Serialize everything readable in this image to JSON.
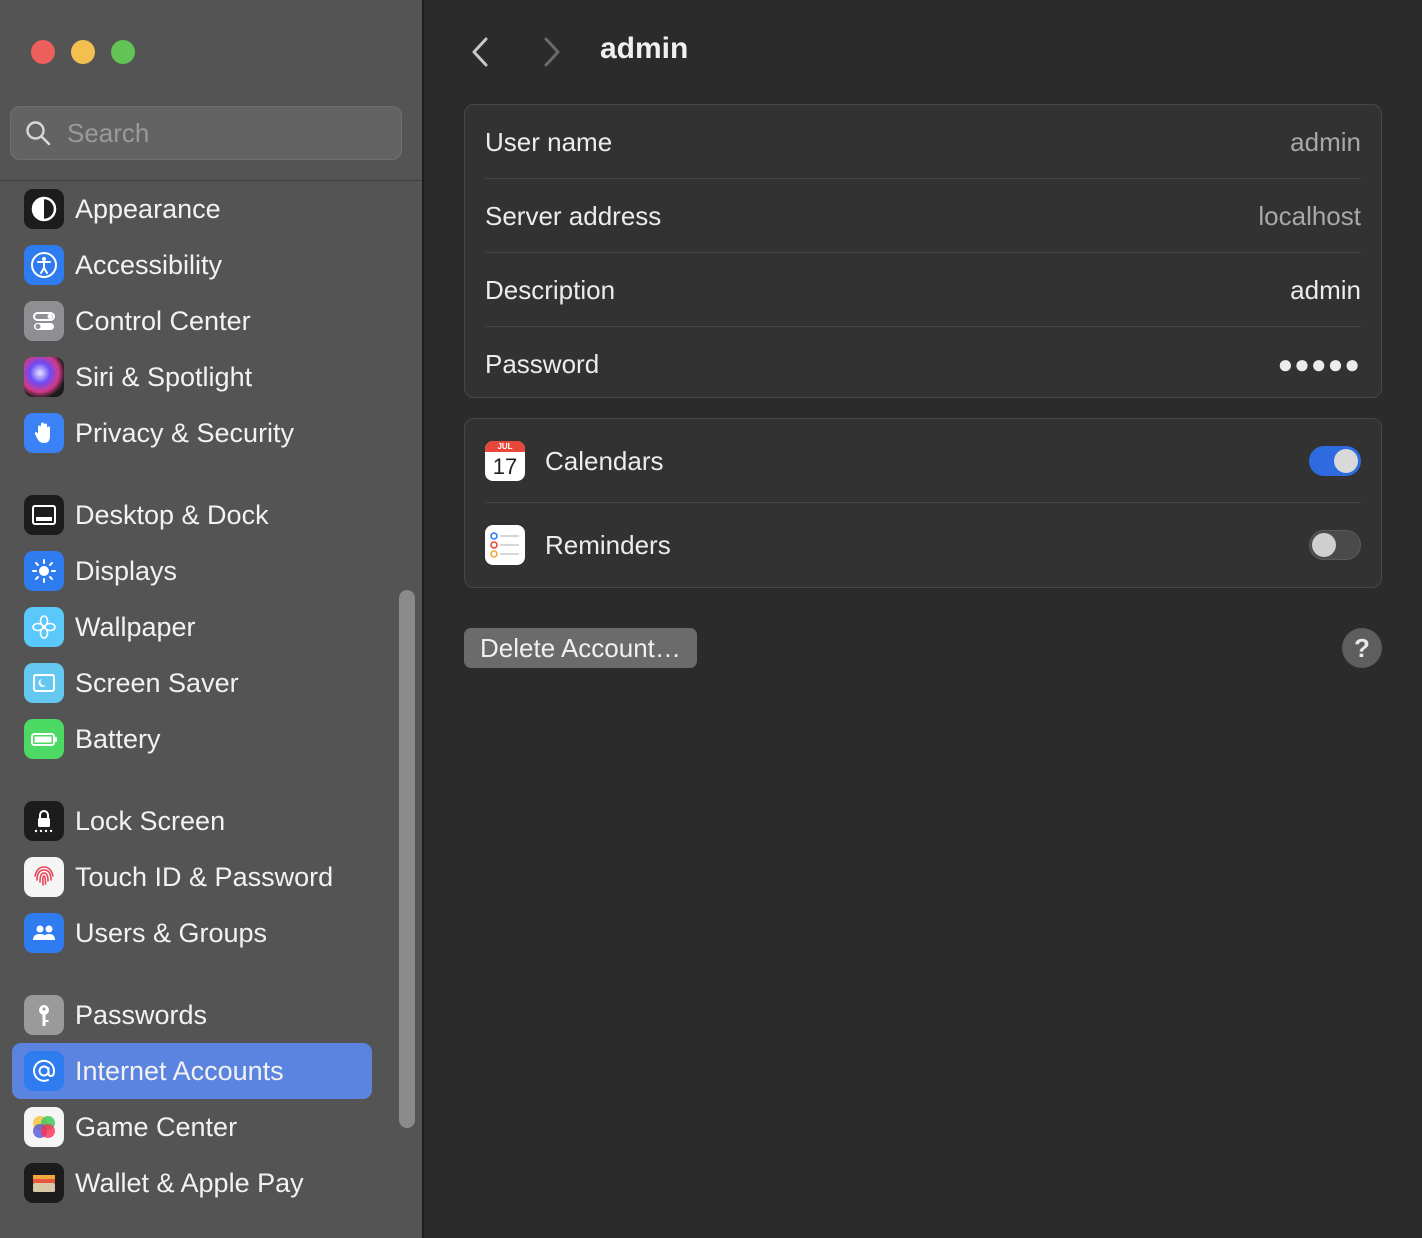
{
  "window": {
    "traffic_lights": [
      "close",
      "minimize",
      "zoom"
    ]
  },
  "search": {
    "placeholder": "Search"
  },
  "sidebar": {
    "items": [
      {
        "label": "Appearance",
        "icon": "appearance-icon"
      },
      {
        "label": "Accessibility",
        "icon": "accessibility-icon"
      },
      {
        "label": "Control Center",
        "icon": "control-center-icon"
      },
      {
        "label": "Siri & Spotlight",
        "icon": "siri-icon"
      },
      {
        "label": "Privacy & Security",
        "icon": "hand-icon"
      },
      {
        "label": "Desktop & Dock",
        "icon": "desktop-dock-icon"
      },
      {
        "label": "Displays",
        "icon": "sun-icon"
      },
      {
        "label": "Wallpaper",
        "icon": "flower-icon"
      },
      {
        "label": "Screen Saver",
        "icon": "screen-saver-icon"
      },
      {
        "label": "Battery",
        "icon": "battery-icon"
      },
      {
        "label": "Lock Screen",
        "icon": "lock-icon"
      },
      {
        "label": "Touch ID & Password",
        "icon": "fingerprint-icon"
      },
      {
        "label": "Users & Groups",
        "icon": "users-icon"
      },
      {
        "label": "Passwords",
        "icon": "key-icon"
      },
      {
        "label": "Internet Accounts",
        "icon": "at-icon",
        "selected": true
      },
      {
        "label": "Game Center",
        "icon": "game-center-icon"
      },
      {
        "label": "Wallet & Apple Pay",
        "icon": "wallet-icon"
      }
    ]
  },
  "header": {
    "title": "admin"
  },
  "account_details": [
    {
      "label": "User name",
      "value": "admin"
    },
    {
      "label": "Server address",
      "value": "localhost"
    },
    {
      "label": "Description",
      "value": "admin"
    },
    {
      "label": "Password",
      "value": "●●●●●"
    }
  ],
  "apps": [
    {
      "label": "Calendars",
      "enabled": true,
      "icon": "calendar-icon",
      "cal_month": "JUL",
      "cal_day": "17"
    },
    {
      "label": "Reminders",
      "enabled": false,
      "icon": "reminders-icon"
    }
  ],
  "actions": {
    "delete_label": "Delete Account…",
    "help_label": "?"
  },
  "colors": {
    "accent": "#2f6be0",
    "selected": "#5b83e0"
  }
}
